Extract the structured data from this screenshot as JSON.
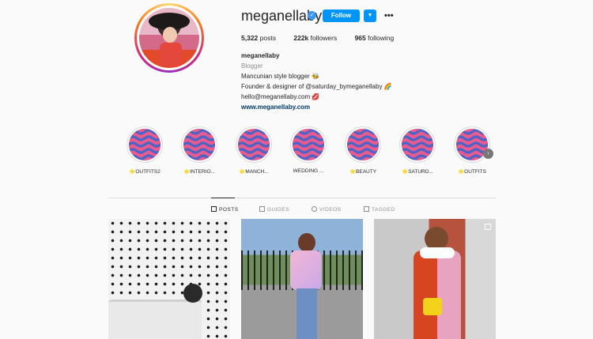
{
  "profile": {
    "username": "meganellaby",
    "follow_label": "Follow",
    "dropdown_icon": "chevron-down-icon",
    "more_icon": "more-horizontal-icon",
    "more_glyph": "•••",
    "verified_glyph": "✓"
  },
  "stats": {
    "posts_num": "5,322",
    "posts_label": "posts",
    "followers_num": "222k",
    "followers_label": "followers",
    "following_num": "965",
    "following_label": "following"
  },
  "bio": {
    "name": "meganellaby",
    "category": "Blogger",
    "line1": "Mancunian style blogger 🐝",
    "line2": "Founder & designer of @saturday_bymeganellaby 🌈",
    "line3": "hello@meganellaby.com 💋",
    "website": "www.meganellaby.com"
  },
  "highlights": [
    {
      "label": "⭐OUTFITS2"
    },
    {
      "label": "⭐INTERIO..."
    },
    {
      "label": "⭐MANCH..."
    },
    {
      "label": "WEDDING ..."
    },
    {
      "label": "⭐BEAUTY"
    },
    {
      "label": "⭐SATURD..."
    },
    {
      "label": "⭐OUTFITS"
    }
  ],
  "highlight_next_glyph": "›",
  "tabs": {
    "posts": "POSTS",
    "guides": "GUIDES",
    "videos": "VIDEOS",
    "tagged": "TAGGED"
  },
  "colors": {
    "accent": "#0095f6",
    "verified": "#3897f0",
    "highlight_pink": "#e95a8f",
    "highlight_blue": "#4a64c8"
  }
}
